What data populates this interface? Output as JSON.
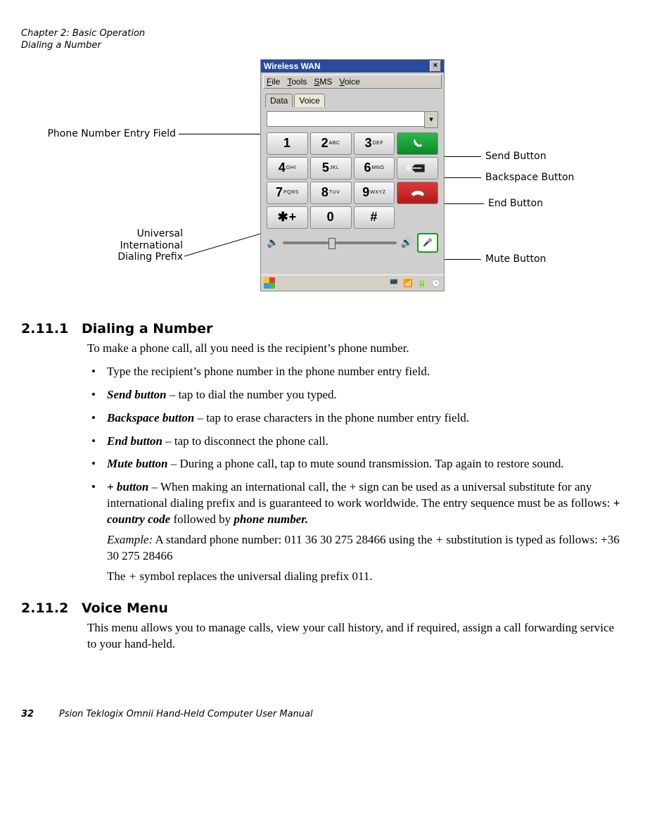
{
  "header": {
    "chapter_line": "Chapter 2:  Basic Operation",
    "section_line": "Dialing a Number"
  },
  "callouts": {
    "entry_field": "Phone Number Entry Field",
    "send": "Send Button",
    "backspace": "Backspace Button",
    "end": "End Button",
    "mute": "Mute Button",
    "intl1": "Universal",
    "intl2": "International",
    "intl3": "Dialing Prefix"
  },
  "shot": {
    "title": "Wireless WAN",
    "close": "×",
    "menu": {
      "file": "File",
      "tools": "Tools",
      "sms": "SMS",
      "voice": "Voice"
    },
    "tabs": {
      "data": "Data",
      "voice": "Voice"
    },
    "drop_glyph": "▾",
    "keys": {
      "k1": "1",
      "k2b": "2",
      "k2s": "ABC",
      "k3b": "3",
      "k3s": "DEF",
      "k4b": "4",
      "k4s": "GHI",
      "k5b": "5",
      "k5s": "JKL",
      "k6b": "6",
      "k6s": "MNO",
      "k7b": "7",
      "k7s": "PQRS",
      "k8b": "8",
      "k8s": "TUV",
      "k9b": "9",
      "k9s": "WXYZ",
      "kstar": "✱",
      "kplus": "+",
      "k0": "0",
      "khash": "#"
    },
    "icons": {
      "spk_low": "🔈",
      "spk_high": "🔊",
      "mic": "🎤"
    }
  },
  "sec1": {
    "num": "2.11.1",
    "title": "Dialing a Number",
    "intro": "To make a phone call, all you need is the recipient’s phone number.",
    "b1": "Type the recipient’s phone number in the phone number entry field.",
    "b2_lead": "Send button",
    "b2_rest": " – tap to dial the number you typed.",
    "b3_lead": "Backspace button",
    "b3_rest": " – tap to erase characters in the phone number entry field.",
    "b4_lead": "End button",
    "b4_rest": " – tap to disconnect the phone call.",
    "b5_lead": "Mute button",
    "b5_rest": " – During a phone call, tap to mute sound transmission. Tap again to restore sound.",
    "b6_pre": " ",
    "b6_lead": "+ button",
    "b6_mid": " – When making an international call, the + sign can be used as a universal substitute for any international dialing prefix and is guaranteed to work worldwide. The entry sequence must be as follows: ",
    "b6_seq1": "+ country code",
    "b6_seq_join": " followed by ",
    "b6_seq2": "phone number.",
    "b6_ex_lead": "Example:",
    "b6_ex_body": " A standard phone number: 011 36 30 275 28466 using the ",
    "b6_ex_plus": "+",
    "b6_ex_tail": " substitution is typed as follows: +36 30 275 28466",
    "b6_closing_a": "The ",
    "b6_closing_plus": "+",
    "b6_closing_b": " symbol replaces the universal dialing prefix 011."
  },
  "sec2": {
    "num": "2.11.2",
    "title": "Voice Menu",
    "body": "This menu allows you to manage calls, view your call history, and if required, assign a call forwarding service to your hand-held."
  },
  "footer": {
    "page": "32",
    "manual": "Psion Teklogix Omnii Hand-Held Computer User Manual"
  }
}
